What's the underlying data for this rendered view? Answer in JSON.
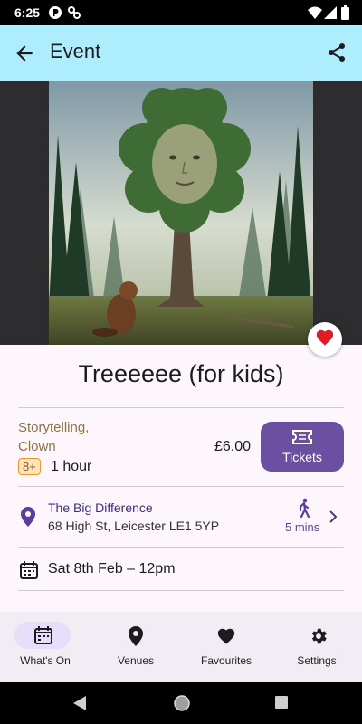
{
  "status_bar": {
    "time": "6:25",
    "left_icons": [
      "notification-p-icon",
      "notification-settings-icon"
    ],
    "right_icons": [
      "wifi-icon",
      "signal-icon",
      "battery-icon"
    ]
  },
  "app_bar": {
    "title": "Event",
    "back_icon": "arrow-back-icon",
    "share_icon": "share-icon",
    "background": "#aeeefc"
  },
  "event": {
    "title": "Treeeeee (for kids)",
    "categories": "Storytelling, Clown",
    "age_rating": "8+",
    "duration": "1 hour",
    "price": "£6.00",
    "tickets_label": "Tickets",
    "favourited": true
  },
  "venue": {
    "name": "The Big Difference",
    "address": "68 High St, Leicester  LE1 5YP",
    "walk_time": "5 mins"
  },
  "schedule": {
    "datetime": "Sat 8th Feb – 12pm"
  },
  "bottom_nav": {
    "items": [
      {
        "label": "What's On",
        "icon": "calendar-icon",
        "active": true
      },
      {
        "label": "Venues",
        "icon": "location-pin-icon",
        "active": false
      },
      {
        "label": "Favourites",
        "icon": "heart-icon",
        "active": false
      },
      {
        "label": "Settings",
        "icon": "gear-icon",
        "active": false
      }
    ]
  },
  "system_nav": [
    "back-triangle-icon",
    "home-circle-icon",
    "recents-square-icon"
  ],
  "colors": {
    "accent": "#6b4fa0",
    "category_text": "#8e7443",
    "favourite_red": "#e01b24",
    "venue_name": "#3b2a8e"
  }
}
